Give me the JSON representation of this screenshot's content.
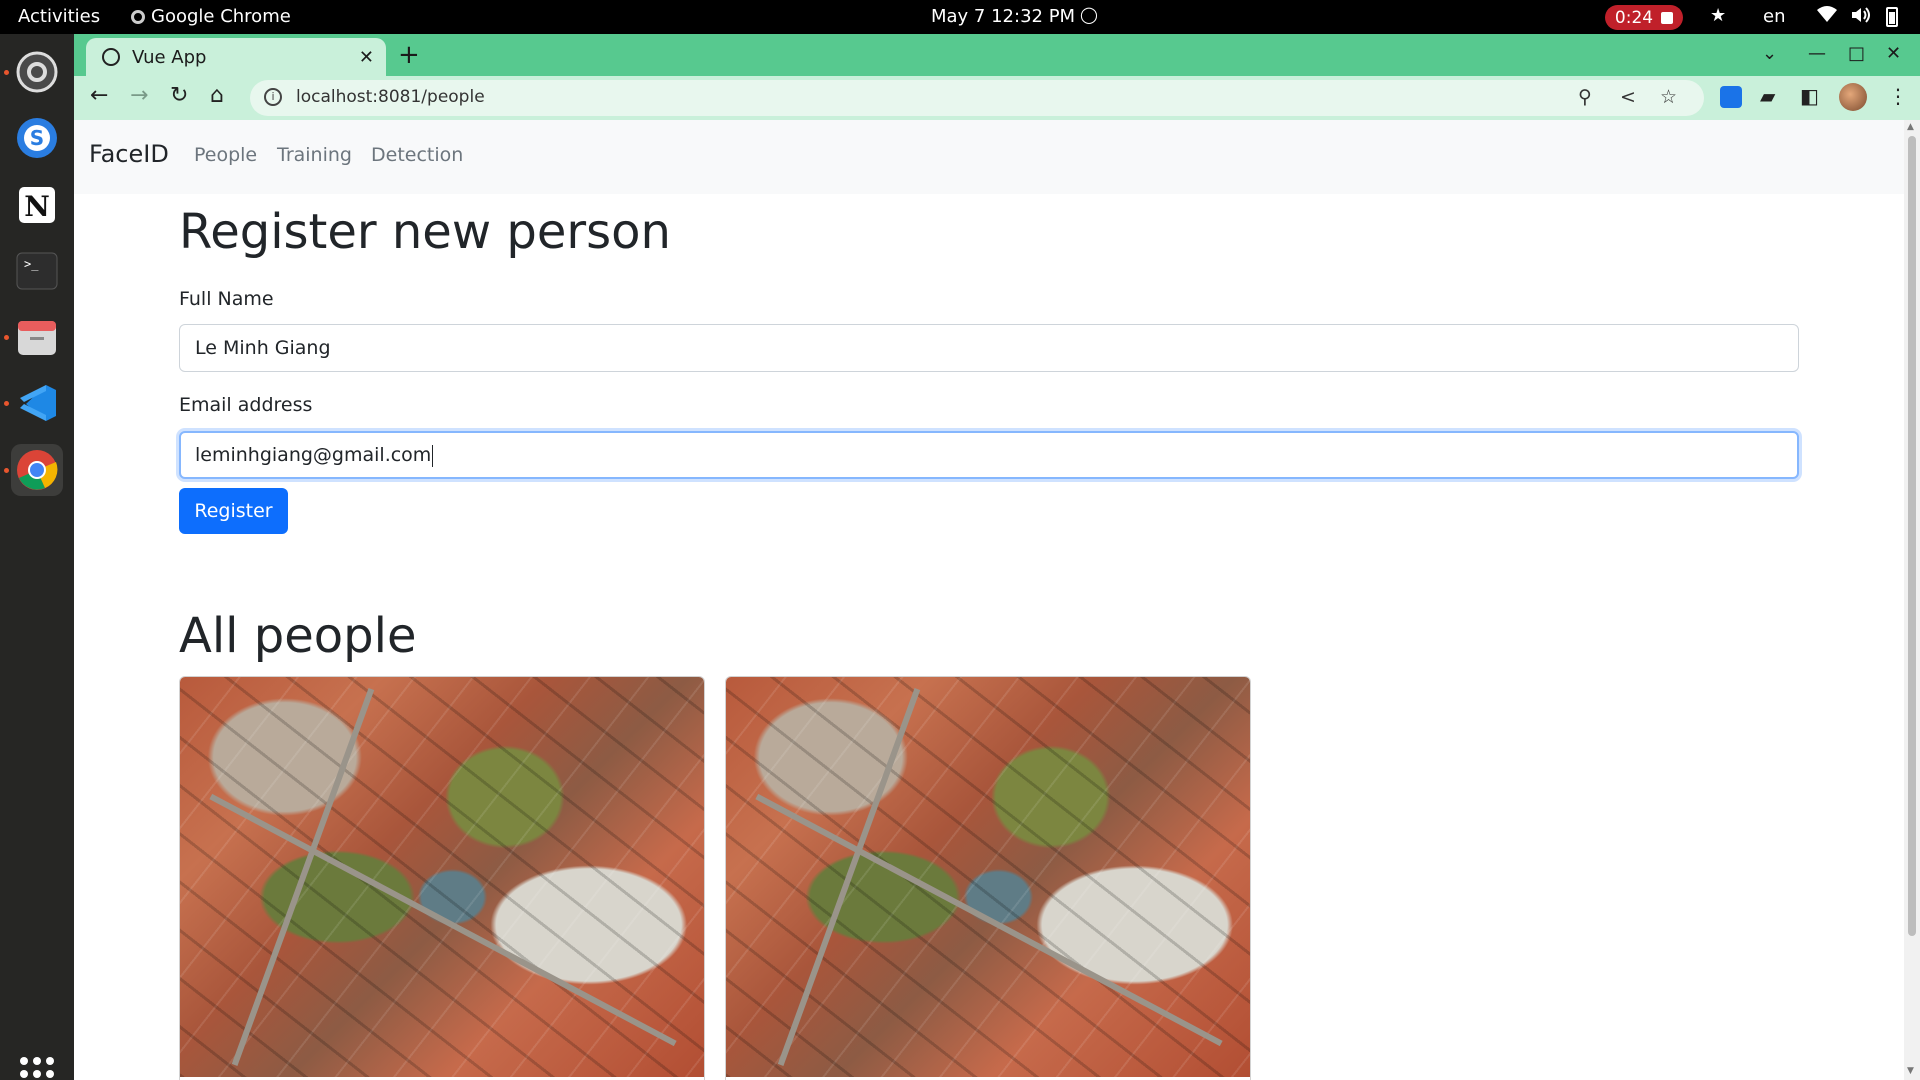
{
  "system_bar": {
    "activities": "Activities",
    "app_name": "Google Chrome",
    "clock": "May 7  12:32 PM",
    "recording_time": "0:24",
    "language": "en"
  },
  "dock": {
    "items": [
      "settings",
      "skype",
      "notion",
      "terminal",
      "files",
      "vscode",
      "chrome"
    ]
  },
  "browser": {
    "tab_title": "Vue App",
    "url": "localhost:8081/people",
    "accent_color": "#57c98f"
  },
  "navbar": {
    "brand": "FaceID",
    "links": [
      "People",
      "Training",
      "Detection"
    ]
  },
  "form": {
    "title": "Register new person",
    "full_name_label": "Full Name",
    "full_name_value": "Le Minh Giang",
    "email_label": "Email address",
    "email_value": "leminhgiang@gmail.com",
    "submit_label": "Register",
    "submit_color": "#0d6efd"
  },
  "people": {
    "title": "All people",
    "cards": [
      {
        "image": "aerial-city-photo"
      },
      {
        "image": "aerial-city-photo"
      }
    ]
  }
}
